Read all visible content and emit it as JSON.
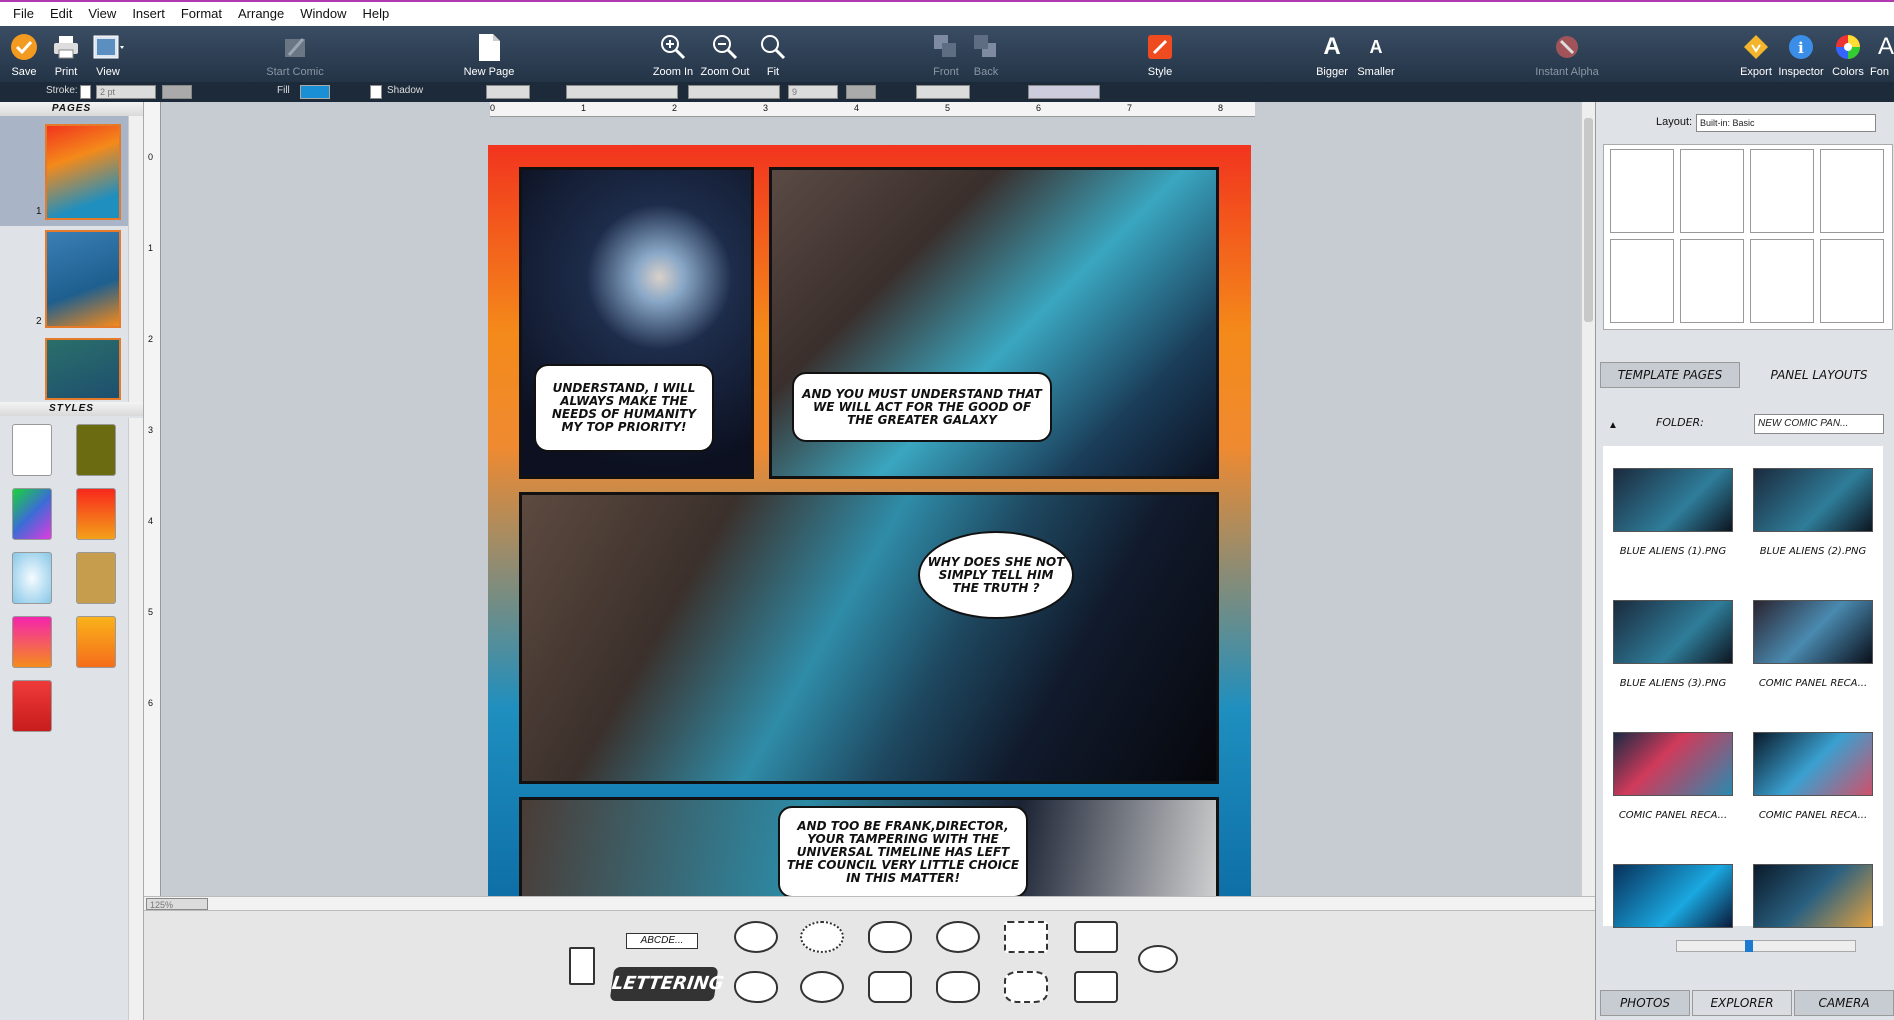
{
  "menu": [
    "File",
    "Edit",
    "View",
    "Insert",
    "Format",
    "Arrange",
    "Window",
    "Help"
  ],
  "toolbar": {
    "save": "Save",
    "print": "Print",
    "view": "View",
    "start_comic": "Start Comic",
    "new_page": "New Page",
    "zoom_in": "Zoom In",
    "zoom_out": "Zoom Out",
    "fit": "Fit",
    "front": "Front",
    "back": "Back",
    "style": "Style",
    "bigger": "Bigger",
    "smaller": "Smaller",
    "instant_alpha": "Instant Alpha",
    "export": "Export",
    "inspector": "Inspector",
    "colors": "Colors",
    "fonts": "Fon"
  },
  "format_bar": {
    "stroke_label": "Stroke:",
    "stroke_value": "2 pt",
    "fill_label": "Fill",
    "shadow_label": "Shadow",
    "font_size": "9"
  },
  "left": {
    "pages_header": "PAGES",
    "page_numbers": [
      "1",
      "2"
    ],
    "styles_header": "STYLES"
  },
  "zoom": "125%",
  "ruler": {
    "h": [
      "0",
      "1",
      "2",
      "3",
      "4",
      "5",
      "6",
      "7",
      "8"
    ],
    "v": [
      "0",
      "1",
      "2",
      "3",
      "4",
      "5",
      "6"
    ]
  },
  "comic": {
    "bubble1": "UNDERSTAND, I WILL ALWAYS MAKE THE NEEDS OF HUMANITY MY TOP PRIORITY!",
    "bubble2": "AND YOU MUST UNDERSTAND THAT WE WILL ACT FOR THE GOOD OF THE GREATER GALAXY",
    "bubble3": "WHY DOES SHE NOT SIMPLY TELL HIM THE TRUTH ?",
    "bubble4": "AND TOO BE FRANK,DIRECTOR, YOUR TAMPERING WITH THE UNIVERSAL TIMELINE HAS LEFT THE COUNCIL VERY LITTLE CHOICE IN THIS MATTER!"
  },
  "tray": {
    "caption_sample": "ABCDE...",
    "lettering": "LETTERING"
  },
  "right": {
    "layout_label": "Layout:",
    "layout_value": "Built-in: Basic",
    "tab_template": "TEMPLATE PAGES",
    "tab_panel": "PANEL LAYOUTS",
    "folder_label": "FOLDER:",
    "folder_value": "NEW COMIC PAN...",
    "files": [
      "BLUE ALIENS (1).PNG",
      "BLUE ALIENS (2).PNG",
      "BLUE ALIENS (3).PNG",
      "COMIC PANEL RECA...",
      "COMIC PANEL RECA...",
      "COMIC PANEL RECA...",
      "",
      ""
    ],
    "tab_photos": "PHOTOS",
    "tab_explorer": "EXPLORER",
    "tab_camera": "CAMERA"
  },
  "colors": {
    "accent_orange": "#f48a1a",
    "accent_blue": "#1e8fbf",
    "toolbar": "#2c3d52"
  }
}
